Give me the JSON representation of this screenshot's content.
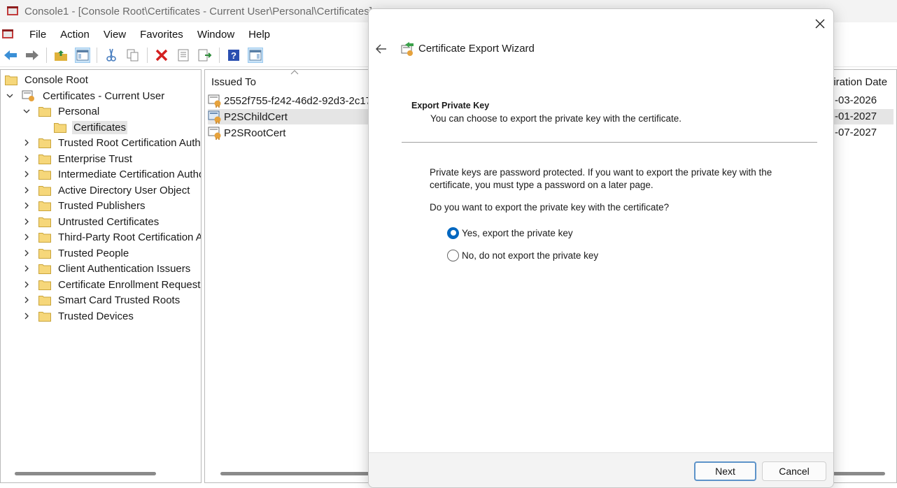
{
  "window": {
    "title": "Console1 - [Console Root\\Certificates - Current User\\Personal\\Certificates]"
  },
  "menu": {
    "items": [
      "File",
      "Action",
      "View",
      "Favorites",
      "Window",
      "Help"
    ]
  },
  "toolbar": {
    "icons": [
      "back-arrow-icon",
      "forward-arrow-icon",
      "up-folder-icon",
      "show-hide-tree-icon",
      "cut-icon",
      "copy-icon",
      "delete-icon",
      "properties-icon",
      "export-list-icon",
      "help-icon",
      "action-pane-icon"
    ]
  },
  "tree": {
    "root": "Console Root",
    "store": "Certificates - Current User",
    "personal": "Personal",
    "certificates": "Certificates",
    "folders": [
      "Trusted Root Certification Autho",
      "Enterprise Trust",
      "Intermediate Certification Autho",
      "Active Directory User Object",
      "Trusted Publishers",
      "Untrusted Certificates",
      "Third-Party Root Certification Au",
      "Trusted People",
      "Client Authentication Issuers",
      "Certificate Enrollment Requests",
      "Smart Card Trusted Roots",
      "Trusted Devices"
    ]
  },
  "list": {
    "col_issued_to": "Issued To",
    "col_expiration": "piration Date",
    "rows": [
      {
        "name": "2552f755-f242-46d2-92d3-2c17",
        "date": "-03-2026"
      },
      {
        "name": "P2SChildCert",
        "date": "-01-2027"
      },
      {
        "name": "P2SRootCert",
        "date": "-07-2027"
      }
    ]
  },
  "wizard": {
    "title": "Certificate Export Wizard",
    "heading": "Export Private Key",
    "subheading": "You can choose to export the private key with the certificate.",
    "paragraph": "Private keys are password protected. If you want to export the private key with the certificate, you must type a password on a later page.",
    "question": "Do you want to export the private key with the certificate?",
    "option_yes": "Yes, export the private key",
    "option_no": "No, do not export the private key",
    "selected": "yes",
    "next_label": "Next",
    "cancel_label": "Cancel"
  },
  "colors": {
    "accent": "#0067c0",
    "folder": "#f3c244",
    "selection": "#e5e5e5"
  }
}
